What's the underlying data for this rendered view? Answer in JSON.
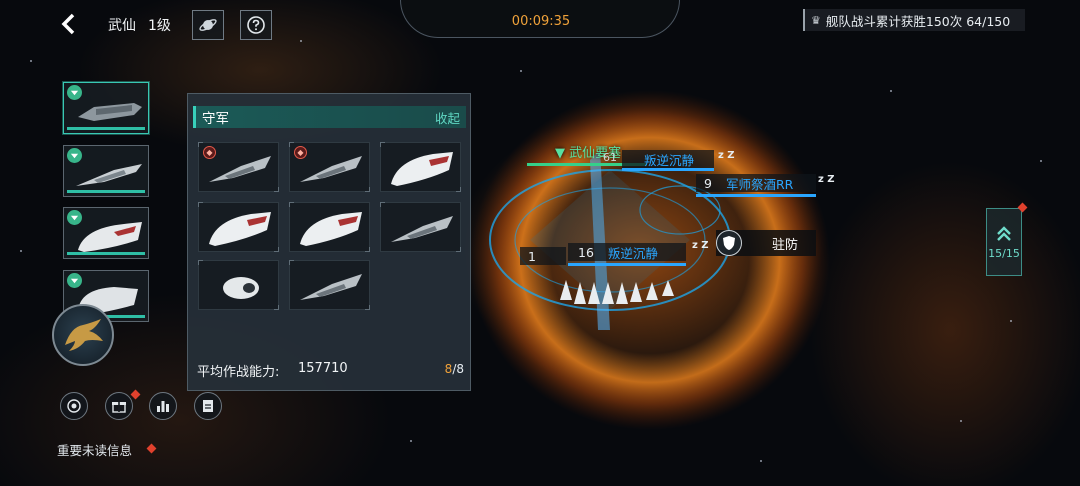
{
  "top_bar": {
    "player_name": "武仙",
    "player_level": "1级",
    "timer": "00:09:35",
    "quest_text": "舰队战斗累计获胜150次 64/150"
  },
  "defense_panel": {
    "title": "守军",
    "collapse_label": "收起",
    "avg_power_label": "平均作战能力:",
    "avg_power_value": "157710",
    "slot_count_current": "8",
    "slot_count_sep": "/",
    "slot_count_total": "8"
  },
  "battle": {
    "fortress_name": "武仙要塞",
    "fortress_value": "61",
    "enemies": [
      {
        "name": "叛逆沉静",
        "level": ""
      },
      {
        "name": "军师祭酒RR",
        "level": "9"
      },
      {
        "name": "叛逆沉静",
        "level": "16"
      },
      {
        "name": "叛逆沉静",
        "level": "1"
      }
    ],
    "sleep_marker": "z Z",
    "station_label": "驻防"
  },
  "right_panel": {
    "squad_count": "15/15"
  },
  "bottom": {
    "unread_label": "重要未读信息"
  },
  "colors": {
    "accent_teal": "#38d0bb",
    "timer_orange": "#f0a23a",
    "enemy_blue": "#2aa6ff",
    "ally_green": "#58e0a0",
    "alert_red": "#e0412d"
  },
  "icons": {
    "back": "chevron-left-icon",
    "planet": "planet-icon",
    "help": "question-mark-icon",
    "trophy": "trophy-icon",
    "shield": "shield-icon",
    "rank_up": "double-chevron-up-icon"
  }
}
